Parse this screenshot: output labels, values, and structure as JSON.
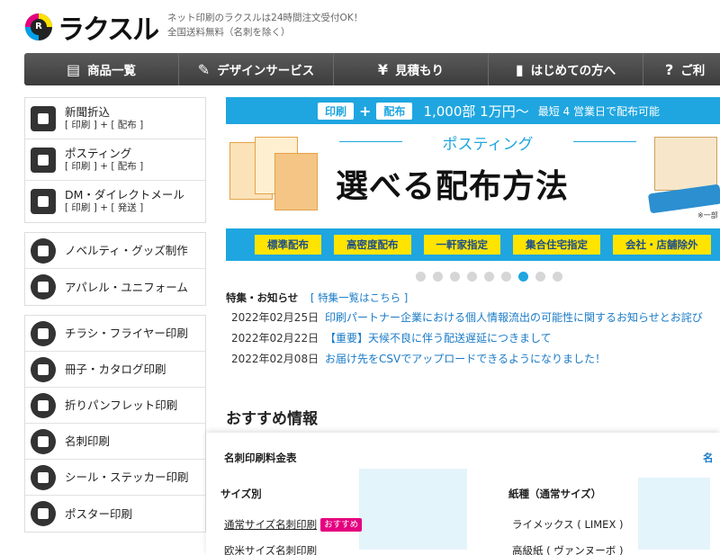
{
  "header": {
    "logo_text": "ラクスル",
    "tagline_1": "ネット印刷のラクスルは24時間注文受付OK！",
    "tagline_2": "全国送料無料（名刺を除く）"
  },
  "nav": [
    {
      "label": "商品一覧",
      "icon": "▤"
    },
    {
      "label": "デザインサービス",
      "icon": "✎"
    },
    {
      "label": "見積もり",
      "icon": "¥"
    },
    {
      "label": "はじめての方へ",
      "icon": "▮"
    },
    {
      "label": "ご利",
      "icon": "?"
    }
  ],
  "sidebar": {
    "group1": [
      {
        "title": "新聞折込",
        "sub": "[ 印刷 ] + [ 配布 ]"
      },
      {
        "title": "ポスティング",
        "sub": "[ 印刷 ] + [ 配布 ]"
      },
      {
        "title": "DM・ダイレクトメール",
        "sub": "[ 印刷 ] + [ 発送 ]"
      }
    ],
    "group2": [
      {
        "title": "ノベルティ・グッズ制作"
      },
      {
        "title": "アパレル・ユニフォーム"
      }
    ],
    "group3": [
      {
        "title": "チラシ・フライヤー印刷"
      },
      {
        "title": "冊子・カタログ印刷"
      },
      {
        "title": "折りパンフレット印刷"
      },
      {
        "title": "名刺印刷"
      },
      {
        "title": "シール・ステッカー印刷"
      },
      {
        "title": "ポスター印刷"
      }
    ]
  },
  "banner": {
    "pill_print": "印刷",
    "plus": "+",
    "pill_distribute": "配布",
    "price": "1,000部 1万円～",
    "lead": "最短 4 営業日で配布可能",
    "subtitle": "ポスティング",
    "headline": "選べる配布方法",
    "note": "※一部",
    "tags": [
      "標準配布",
      "高密度配布",
      "一軒家指定",
      "集合住宅指定",
      "会社・店舗除外"
    ]
  },
  "carousel": {
    "count": 9,
    "active": 7
  },
  "news": {
    "label": "特集・お知らせ",
    "link": "[ 特集一覧はこちら ]",
    "items": [
      {
        "date": "2022年02月25日",
        "title": "印刷パートナー企業における個人情報流出の可能性に関するお知らせとお詫び"
      },
      {
        "date": "2022年02月22日",
        "title": "【重要】天候不良に伴う配送遅延につきまして"
      },
      {
        "date": "2022年02月08日",
        "title": "お届け先をCSVでアップロードできるようになりました！"
      }
    ]
  },
  "recommend": {
    "title": "おすすめ情報"
  },
  "overlay": {
    "title": "名刺印刷料金表",
    "more": "名",
    "size_heading": "サイズ別",
    "size_items": [
      {
        "label": "通常サイズ名刺印刷",
        "badge": "おすすめ"
      },
      {
        "label": "欧米サイズ名刺印刷",
        "badge": ""
      }
    ],
    "paper_heading": "紙種（通常サイズ）",
    "paper_items": [
      {
        "label": "ライメックス ( LIMEX )"
      },
      {
        "label": "高級紙 ( ヴァンヌーボ )"
      }
    ]
  },
  "colors": {
    "accent": "#1fa6e0",
    "nav_bg": "#4a4a4a",
    "link": "#1a7bc7",
    "badge": "#e4007f",
    "tag_bg": "#ffe400"
  }
}
